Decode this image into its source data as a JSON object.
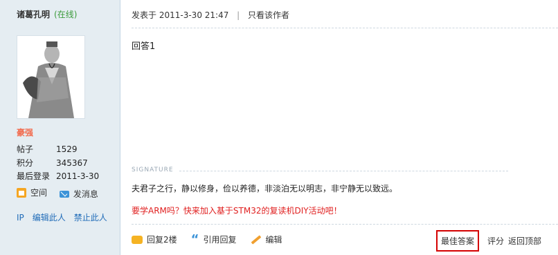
{
  "author": {
    "name": "诸葛孔明",
    "status": "(在线)",
    "rank": "豪强",
    "stats": [
      {
        "label": "帖子",
        "value": "1529"
      },
      {
        "label": "积分",
        "value": "345367"
      },
      {
        "label": "最后登录",
        "value": "2011-3-30"
      }
    ],
    "actions": [
      {
        "label": "空间",
        "icon": "home-icon"
      },
      {
        "label": "发消息",
        "icon": "mail-icon"
      }
    ],
    "admin_links": [
      "IP",
      "编辑此人",
      "禁止此人"
    ]
  },
  "post": {
    "posted_prefix": "发表于",
    "posted_time": "2011-3-30 21:47",
    "separator": "|",
    "only_author": "只看该作者",
    "content": "回答1",
    "signature_label": "SIGNATURE",
    "signature_text": "夫君子之行，静以修身，俭以养德，非淡泊无以明志，非宁静无以致远。",
    "promo_text": "要学ARM吗？快来加入基于STM32的复读机DIY活动吧！",
    "footer_actions": [
      {
        "label": "回复2楼",
        "icon": "reply-icon"
      },
      {
        "label": "引用回复",
        "icon": "quote-icon"
      },
      {
        "label": "编辑",
        "icon": "pencil-icon"
      }
    ],
    "right_actions": {
      "best_answer": "最佳答案",
      "rate": "评分",
      "back_top": "返回顶部"
    }
  },
  "colors": {
    "sidebar_bg": "#e5edf2",
    "online_green": "#3a9a3a",
    "rank_orange": "#f26c4f",
    "link_blue": "#1f6bb8",
    "promo_red": "#e02020",
    "highlight_red": "#d40000"
  }
}
